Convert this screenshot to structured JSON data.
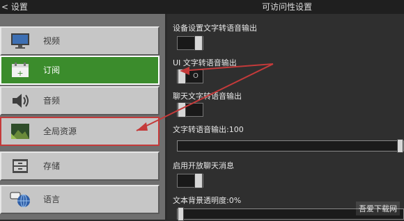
{
  "header": {
    "back_label": "设置",
    "title": "可访问性设置"
  },
  "sidebar": {
    "items": [
      {
        "label": "视频",
        "icon": "monitor-icon"
      },
      {
        "label": "订阅",
        "icon": "calendar-icon"
      },
      {
        "label": "音频",
        "icon": "speaker-icon"
      },
      {
        "label": "全局资源",
        "icon": "landscape-icon"
      },
      {
        "label": "存储",
        "icon": "drawer-icon"
      },
      {
        "label": "语言",
        "icon": "globe-chat-icon"
      }
    ],
    "active_index": 1,
    "highlighted_index": 3
  },
  "settings": {
    "tts_device": {
      "label": "设备设置文字转语音输出"
    },
    "tts_ui": {
      "label": "UI 文字转语音输出",
      "state": "O"
    },
    "tts_chat": {
      "label": "聊天文字转语音输出"
    },
    "tts_volume": {
      "label": "文字转语音输出:100",
      "value": 100
    },
    "open_chat": {
      "label": "启用开放聊天消息"
    },
    "bg_opacity": {
      "label": "文本背景透明度:0%",
      "value": 0
    }
  },
  "watermark": {
    "text": "吾爱下载网"
  },
  "colors": {
    "active_green": "#3b8c2c",
    "annotation_red": "#c43a3a"
  }
}
